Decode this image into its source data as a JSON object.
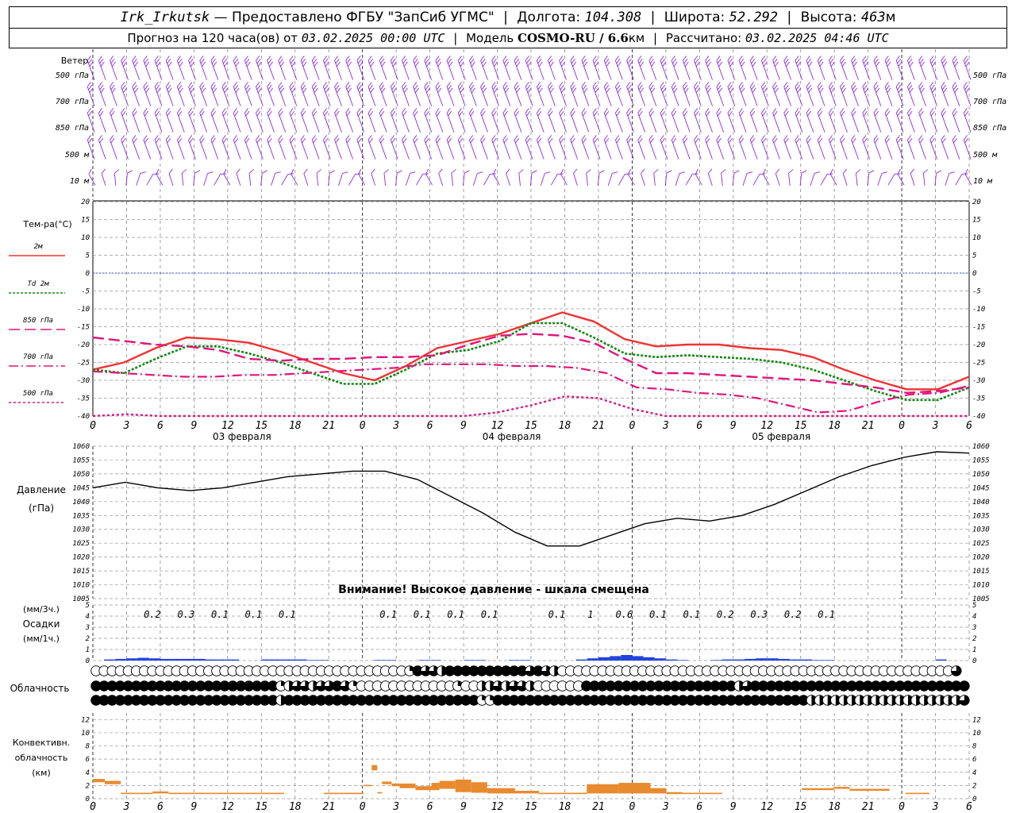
{
  "header": {
    "station": "Irk_Irkutsk",
    "provider": "— Предоставлено ФГБУ \"ЗапСиб УГМС\"",
    "lon_label": "Долгота:",
    "lon": "104.308",
    "lat_label": "Широта:",
    "lat": "52.292",
    "alt_label": "Высота:",
    "alt": "463",
    "alt_unit": "м",
    "forecast_label": "Прогноз на 120 часа(ов) от",
    "forecast_start": "03.02.2025 00:00 UTC",
    "model_label": "Модель",
    "model": "COSMO-RU / 6.6",
    "model_unit": "км",
    "calc_label": "Рассчитано:",
    "calc_time": "03.02.2025 04:46 UTC"
  },
  "wind_panel": {
    "title": "Ветер",
    "levels": [
      "500 гПа",
      "700 гПа",
      "850 гПа",
      "500 м",
      "10 м"
    ],
    "barb_color": "#8a2be2"
  },
  "colors": {
    "t2m": "#ee3333",
    "td2m": "#118811",
    "t850": "#e0157a",
    "t700": "#e0157a",
    "t500": "#e0157a",
    "pressure": "#000000",
    "precip": "#2244dd",
    "convective": "#e88a2e",
    "zero_line": "#3355dd"
  },
  "time_axis": {
    "tick_labels": [
      "0",
      "3",
      "6",
      "9",
      "12",
      "15",
      "18",
      "21",
      "0",
      "3",
      "6",
      "9",
      "12",
      "15",
      "18",
      "21",
      "0",
      "3",
      "6",
      "9",
      "12",
      "15",
      "18",
      "21",
      "0",
      "3",
      "6"
    ],
    "dates": [
      "03 февраля",
      "04 февраля",
      "05 февраля"
    ]
  },
  "temp_panel": {
    "ylabel": "Тем-ра(°C)",
    "yticks": [
      "20",
      "15",
      "10",
      "5",
      "0",
      "-5",
      "-10",
      "-15",
      "-20",
      "-25",
      "-30",
      "-35",
      "-40"
    ],
    "legend": [
      {
        "label": "2м",
        "color": "#ee3333",
        "dash": ""
      },
      {
        "label": "Td 2м",
        "color": "#118811",
        "dash": "3,2"
      },
      {
        "label": "850 гПа",
        "color": "#e0157a",
        "dash": "14,6"
      },
      {
        "label": "700 гПа",
        "color": "#e0157a",
        "dash": "12,4,2,4"
      },
      {
        "label": "500 гПа",
        "color": "#e0157a",
        "dash": "3,3"
      }
    ]
  },
  "pressure_panel": {
    "ylabel_1": "Давление",
    "ylabel_2": "(гПа)",
    "yticks": [
      "1060",
      "1055",
      "1050",
      "1045",
      "1040",
      "1035",
      "1030",
      "1025",
      "1020",
      "1015",
      "1010",
      "1005"
    ],
    "warning": "Внимание! Высокое давление - шкала смещена"
  },
  "precip_panel": {
    "ylabel_1": "(мм/3ч.)",
    "ylabel_2": "Осадки",
    "ylabel_3": "(мм/1ч.)",
    "yticks": [
      "5",
      "4",
      "3",
      "2",
      "1",
      "0"
    ],
    "labels": [
      {
        "hour": 6,
        "text": "0.2"
      },
      {
        "hour": 9,
        "text": "0.3"
      },
      {
        "hour": 12,
        "text": "0.1"
      },
      {
        "hour": 15,
        "text": "0.1"
      },
      {
        "hour": 18,
        "text": "0.1"
      },
      {
        "hour": 27,
        "text": "0.1"
      },
      {
        "hour": 30,
        "text": "0.1"
      },
      {
        "hour": 33,
        "text": "0.1"
      },
      {
        "hour": 36,
        "text": "0.1"
      },
      {
        "hour": 42,
        "text": "0.1"
      },
      {
        "hour": 45,
        "text": "1"
      },
      {
        "hour": 48,
        "text": "0.6"
      },
      {
        "hour": 51,
        "text": "0.1"
      },
      {
        "hour": 54,
        "text": "0.1"
      },
      {
        "hour": 57,
        "text": "0.2"
      },
      {
        "hour": 60,
        "text": "0.3"
      },
      {
        "hour": 63,
        "text": "0.2"
      },
      {
        "hour": 66,
        "text": "0.1"
      }
    ]
  },
  "cloud_panel": {
    "ylabel": "Облачность"
  },
  "conv_panel": {
    "ylabel_1": "Конвективн.",
    "ylabel_2": "облачность",
    "ylabel_3": "(км)",
    "yticks": [
      "12",
      "10",
      "8",
      "6",
      "4",
      "2",
      "0"
    ]
  },
  "chart_data": {
    "type": "line",
    "x_unit": "hours since 03.02.2025 00:00 UTC",
    "xlim": [
      0,
      78
    ],
    "temperature": {
      "ylim": [
        -40,
        20
      ],
      "series": [
        {
          "name": "2м",
          "x": [
            0,
            3,
            6,
            9,
            12,
            15,
            18,
            21,
            24,
            27,
            30,
            33,
            36,
            39,
            42,
            45,
            48,
            51,
            54,
            57,
            60,
            63,
            66,
            69,
            72,
            75,
            78
          ],
          "values": [
            -27,
            -25,
            -21,
            -18,
            -18.5,
            -19.5,
            -22,
            -25,
            -28,
            -30,
            -26,
            -21,
            -19,
            -17,
            -14,
            -11,
            -13.5,
            -18.5,
            -20.5,
            -20,
            -20,
            -21,
            -21.5,
            -23.5,
            -27,
            -30,
            -32.5,
            -32.5,
            -29
          ]
        },
        {
          "name": "Td 2м",
          "x": [
            0,
            3,
            6,
            9,
            12,
            15,
            18,
            21,
            24,
            27,
            30,
            33,
            36,
            39,
            42,
            45,
            48,
            51,
            54,
            57,
            60,
            63,
            66,
            69,
            72,
            75,
            78
          ],
          "values": [
            -27,
            -28,
            -24,
            -20.5,
            -20.5,
            -22.5,
            -25,
            -28,
            -31,
            -31,
            -27,
            -22.5,
            -21.5,
            -19,
            -14,
            -14,
            -18,
            -22.5,
            -23.5,
            -23,
            -23.5,
            -24,
            -25,
            -27,
            -30,
            -33,
            -35.5,
            -35.5,
            -32
          ]
        },
        {
          "name": "850 гПа",
          "x": [
            0,
            3,
            6,
            9,
            12,
            15,
            18,
            21,
            24,
            27,
            30,
            33,
            36,
            39,
            42,
            45,
            48,
            51,
            54,
            57,
            60,
            63,
            66,
            69,
            72,
            75,
            78
          ],
          "values": [
            -18,
            -19,
            -20,
            -20.5,
            -21.5,
            -24,
            -24.5,
            -24,
            -24,
            -23.5,
            -23.5,
            -23,
            -20,
            -17.5,
            -17,
            -17.5,
            -19.5,
            -24,
            -28,
            -28,
            -28.5,
            -29,
            -29.5,
            -30,
            -31,
            -32,
            -33.5,
            -33,
            -32
          ]
        },
        {
          "name": "700 гПа",
          "x": [
            0,
            3,
            6,
            9,
            12,
            15,
            18,
            21,
            24,
            27,
            30,
            33,
            36,
            39,
            42,
            45,
            48,
            51,
            54,
            57,
            60,
            63,
            66,
            69,
            72,
            75,
            78
          ],
          "values": [
            -27.5,
            -28,
            -28.5,
            -29,
            -29,
            -28.5,
            -28.5,
            -28,
            -27.5,
            -27,
            -26.5,
            -25.5,
            -25.5,
            -25.5,
            -26,
            -26,
            -26.5,
            -28,
            -32,
            -32.5,
            -33.5,
            -34,
            -35,
            -37,
            -39,
            -38.5,
            -36,
            -34,
            -33.5,
            -31.5
          ]
        },
        {
          "name": "500 гПа",
          "x": [
            0,
            3,
            6,
            9,
            12,
            15,
            18,
            21,
            24,
            27,
            30,
            33,
            36,
            39,
            42,
            45,
            48,
            51,
            54,
            57,
            60,
            63,
            66,
            69,
            72,
            75,
            78
          ],
          "values": [
            -40,
            -39.5,
            -42,
            -44,
            -45,
            -45,
            -45,
            -45,
            -45,
            -45,
            -44,
            -40,
            -39,
            -37,
            -34.5,
            -35,
            -38,
            -40,
            -42,
            -43,
            -44,
            -45,
            -45,
            -45,
            -45,
            -45,
            -45
          ]
        }
      ]
    },
    "pressure": {
      "ylim": [
        1005,
        1060
      ],
      "series": [
        {
          "name": "pressure",
          "x": [
            0,
            3,
            6,
            9,
            12,
            15,
            18,
            21,
            24,
            27,
            30,
            33,
            36,
            39,
            42,
            45,
            48,
            51,
            54,
            57,
            60,
            63,
            66,
            69,
            72,
            75,
            78
          ],
          "values": [
            1045,
            1047,
            1045,
            1044,
            1045,
            1047,
            1049,
            1050,
            1051,
            1051,
            1048,
            1042,
            1036,
            1029,
            1024,
            1024,
            1028,
            1032,
            1034,
            1033,
            1035,
            1039,
            1044,
            1049,
            1053,
            1056,
            1058,
            1057.5
          ]
        }
      ]
    },
    "precip": {
      "ylim": [
        0,
        5
      ],
      "hourly": [
        0,
        0.1,
        0.15,
        0.2,
        0.25,
        0.2,
        0.15,
        0.15,
        0.15,
        0.15,
        0.1,
        0.1,
        0.1,
        0,
        0,
        0.1,
        0.1,
        0.1,
        0.1,
        0.05,
        0.05,
        0,
        0,
        0,
        0,
        0.05,
        0.05,
        0,
        0,
        0.05,
        0.05,
        0,
        0,
        0.05,
        0.05,
        0,
        0,
        0.05,
        0.05,
        0,
        0,
        0,
        0,
        0.1,
        0.2,
        0.3,
        0.4,
        0.5,
        0.4,
        0.3,
        0.2,
        0.1,
        0.05,
        0,
        0,
        0.05,
        0.1,
        0.1,
        0.15,
        0.2,
        0.2,
        0.15,
        0.1,
        0.1,
        0.05,
        0.05,
        0,
        0,
        0,
        0,
        0,
        0,
        0,
        0,
        0,
        0.1,
        0,
        0
      ]
    },
    "clouds": {
      "rows": [
        "upper",
        "middle",
        "lower"
      ],
      "cover_eighths": {
        "upper": [
          0,
          0,
          0,
          0,
          0,
          0,
          0,
          0,
          0,
          0,
          0,
          0,
          0,
          0,
          0,
          0,
          0,
          0,
          0,
          0,
          0,
          0,
          0,
          0,
          0,
          0,
          0,
          0,
          0,
          0,
          0,
          0,
          0,
          0,
          0,
          0,
          0,
          0,
          0,
          2,
          8,
          6,
          6,
          4,
          8,
          8,
          8,
          8,
          8,
          8,
          8,
          8,
          8,
          8,
          6,
          8,
          6,
          4,
          0,
          0,
          0,
          0,
          0,
          0,
          0,
          0,
          0,
          0,
          0,
          0,
          0,
          0,
          0,
          0,
          0,
          0,
          0,
          0,
          0,
          0,
          0,
          0,
          0,
          0,
          0,
          0,
          0,
          0,
          0,
          0,
          0,
          0,
          0,
          0,
          0,
          0,
          0,
          0,
          0,
          0,
          0,
          0,
          0,
          0,
          0,
          0,
          0,
          6
        ],
        "middle": [
          8,
          8,
          8,
          8,
          8,
          8,
          8,
          8,
          8,
          8,
          8,
          8,
          8,
          8,
          8,
          8,
          8,
          8,
          8,
          8,
          8,
          8,
          8,
          2,
          4,
          6,
          6,
          4,
          6,
          6,
          8,
          6,
          2,
          0,
          0,
          0,
          0,
          0,
          0,
          0,
          0,
          0,
          0,
          0,
          0,
          2,
          0,
          0,
          4,
          4,
          6,
          4,
          6,
          6,
          4,
          0,
          0,
          0,
          0,
          0,
          0,
          8,
          8,
          8,
          8,
          8,
          8,
          8,
          8,
          8,
          8,
          8,
          8,
          8,
          8,
          8,
          8,
          8,
          8,
          8,
          4,
          6,
          8,
          8,
          8,
          8,
          8,
          8,
          8,
          8,
          8,
          8,
          8,
          8,
          8,
          8,
          8,
          8,
          8,
          8,
          8,
          8,
          8,
          8,
          8,
          8,
          8,
          8,
          8
        ],
        "lower": [
          8,
          8,
          8,
          8,
          8,
          8,
          8,
          8,
          8,
          8,
          8,
          8,
          8,
          8,
          8,
          8,
          8,
          8,
          8,
          8,
          8,
          8,
          8,
          4,
          8,
          8,
          8,
          8,
          8,
          8,
          8,
          8,
          8,
          8,
          8,
          8,
          8,
          8,
          8,
          8,
          8,
          8,
          8,
          8,
          8,
          8,
          8,
          8,
          2,
          2,
          8,
          8,
          8,
          8,
          8,
          8,
          8,
          8,
          8,
          8,
          8,
          8,
          8,
          8,
          8,
          8,
          8,
          8,
          8,
          8,
          8,
          8,
          8,
          8,
          8,
          8,
          8,
          8,
          8,
          8,
          8,
          8,
          8,
          8,
          8,
          8,
          8,
          8,
          8,
          4,
          4,
          4,
          4,
          4,
          4,
          4,
          4,
          4,
          4,
          4,
          4,
          4,
          4,
          4,
          4,
          4,
          4,
          4,
          6
        ]
      }
    },
    "convective": {
      "ylim": [
        0,
        13
      ],
      "segments": [
        {
          "from": 0,
          "to": 1.5,
          "base": 2.5,
          "top": 3
        },
        {
          "from": 1.5,
          "to": 3.5,
          "base": 2.2,
          "top": 2.7
        },
        {
          "from": 3.5,
          "to": 7.5,
          "base": 0.7,
          "top": 0.9
        },
        {
          "from": 7.5,
          "to": 9.5,
          "base": 0.8,
          "top": 1.1
        },
        {
          "from": 9.5,
          "to": 24,
          "base": 0.7,
          "top": 0.9
        },
        {
          "from": 29,
          "to": 34,
          "base": 0.7,
          "top": 0.9
        },
        {
          "from": 34,
          "to": 35,
          "base": 1.9,
          "top": 2.1
        },
        {
          "from": 35,
          "to": 35.7,
          "base": 4.3,
          "top": 5.1
        },
        {
          "from": 35.7,
          "to": 36.3,
          "base": 0.8,
          "top": 1.0
        },
        {
          "from": 36.3,
          "to": 37.5,
          "base": 2.2,
          "top": 2.6
        },
        {
          "from": 37.5,
          "to": 38.5,
          "base": 1.9,
          "top": 2.3
        },
        {
          "from": 38.5,
          "to": 40.5,
          "base": 1.6,
          "top": 2.3
        },
        {
          "from": 40.5,
          "to": 42.5,
          "base": 1.3,
          "top": 1.9
        },
        {
          "from": 42.5,
          "to": 43.5,
          "base": 1.3,
          "top": 2.4
        },
        {
          "from": 43.5,
          "to": 45.5,
          "base": 1.5,
          "top": 2.7
        },
        {
          "from": 45.5,
          "to": 47.5,
          "base": 1.0,
          "top": 2.9
        },
        {
          "from": 47.5,
          "to": 49.5,
          "base": 0.9,
          "top": 2.5
        },
        {
          "from": 49.5,
          "to": 53,
          "base": 0.8,
          "top": 1.6
        },
        {
          "from": 53,
          "to": 56,
          "base": 0.8,
          "top": 1.2
        },
        {
          "from": 56,
          "to": 62,
          "base": 0.7,
          "top": 0.9
        },
        {
          "from": 62,
          "to": 66,
          "base": 0.8,
          "top": 2.2
        },
        {
          "from": 66,
          "to": 70,
          "base": 0.8,
          "top": 2.4
        },
        {
          "from": 70,
          "to": 72,
          "base": 0.8,
          "top": 1.6
        },
        {
          "from": 72,
          "to": 74,
          "base": 0.7,
          "top": 1.0
        },
        {
          "from": 74,
          "to": 79,
          "base": 0.7,
          "top": 0.9
        },
        {
          "from": 89,
          "to": 93,
          "base": 1.3,
          "top": 1.6
        },
        {
          "from": 93,
          "to": 95,
          "base": 1.5,
          "top": 1.8
        },
        {
          "from": 95,
          "to": 100,
          "base": 1.2,
          "top": 1.5
        },
        {
          "from": 102,
          "to": 105,
          "base": 0.7,
          "top": 0.9
        }
      ]
    }
  }
}
